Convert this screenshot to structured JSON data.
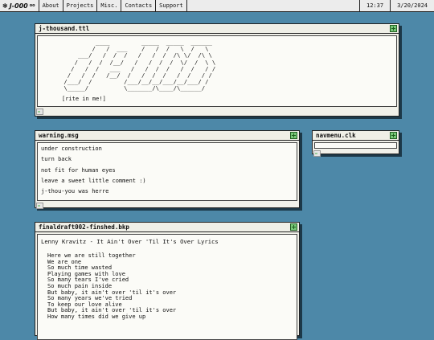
{
  "menubar": {
    "logo_mark": "❃",
    "logo_text": "J-000",
    "logo_super": "oo",
    "items": [
      "About",
      "Projects",
      "Misc.",
      "Contacts",
      "Support"
    ],
    "time": "12:37",
    "date": "3/20/2024"
  },
  "window_thousand": {
    "title": "j-thousand.ttl",
    "ascii_art": "          ____         _____  _____  ______\n         /   /  ___    /   /  /   \\  /   \\\n     ___/   /  /  /   /   /  /  /\\ \\/  /\\ \\\n    /   /  /  /__/   /   /  /  /  \\/  /  \\ \\\n   /   /  /   ___   /   /  /  /   /  /   / /\n  /   /  /   /__/  /   /  /  /   /  /   / /\n /___/  /         /___/__/__/___/__/___/ /\n \\_____/          \\_______/\\____/\\______/",
    "write_link": "[rite in me!]"
  },
  "window_warning": {
    "title": "warning.msg",
    "lines": [
      "under construction",
      "turn back",
      "not fit for human eyes",
      "leave a sweet little comment :)",
      "j-thou-you was herre"
    ]
  },
  "window_navmenu": {
    "title": "navmenu.clk"
  },
  "window_final": {
    "title": "finaldraft002-finshed.bkp",
    "song_title": "Lenny Kravitz - It Ain't Over 'Til It's Over Lyrics",
    "lines": [
      "Here we are still together",
      "We are one",
      "So much time wasted",
      "Playing games with love",
      "So many tears I've cried",
      "So much pain inside",
      "But baby, it ain't over 'til it's over",
      "So many years we've tried",
      "To keep our love alive",
      "But baby, it ain't over 'til it's over",
      "How many times did we give up"
    ]
  },
  "colors": {
    "desktop": "#4d88a8",
    "window_bg": "#f1f1ea",
    "close_box": "#78c878"
  }
}
